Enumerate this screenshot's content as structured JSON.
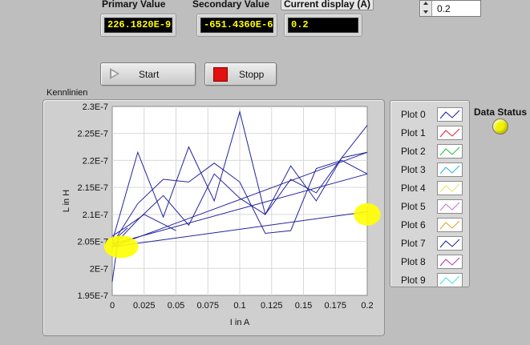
{
  "indicators": {
    "primary": {
      "label": "Primary Value",
      "value": "226.1820E-9"
    },
    "secondary": {
      "label": "Secondary Value",
      "value": "-651.4360E-6"
    },
    "current": {
      "label": "Current display (A)",
      "value": "0.2"
    }
  },
  "top_control": {
    "value": "0.2"
  },
  "buttons": {
    "start": "Start",
    "stop": "Stopp"
  },
  "graph": {
    "label": "Kennlinien"
  },
  "legend": {
    "items": [
      {
        "name": "Plot 0",
        "color": "#1a1ab0"
      },
      {
        "name": "Plot 1",
        "color": "#e0203a"
      },
      {
        "name": "Plot 2",
        "color": "#20c040"
      },
      {
        "name": "Plot 3",
        "color": "#30b0e0"
      },
      {
        "name": "Plot 4",
        "color": "#e8e060"
      },
      {
        "name": "Plot 5",
        "color": "#c070d0"
      },
      {
        "name": "Plot 6",
        "color": "#e0a020"
      },
      {
        "name": "Plot 7",
        "color": "#1a1ab0"
      },
      {
        "name": "Plot 8",
        "color": "#c030a0"
      },
      {
        "name": "Plot 9",
        "color": "#40e0e0"
      }
    ]
  },
  "status": {
    "label": "Data Status",
    "led_color": "#f2f200"
  },
  "chart_data": {
    "type": "line",
    "xlabel": "I in A",
    "ylabel": "L in H",
    "xlim": [
      0,
      0.2
    ],
    "ylim": [
      1.95e-07,
      2.3e-07
    ],
    "x_ticks": [
      "0",
      "0.025",
      "0.05",
      "0.075",
      "0.1",
      "0.125",
      "0.15",
      "0.175",
      "0.2"
    ],
    "y_ticks": [
      "1.95E-7",
      "2E-7",
      "2.05E-7",
      "2.1E-7",
      "2.15E-7",
      "2.2E-7",
      "2.25E-7",
      "2.3E-7"
    ],
    "grid": true,
    "line_color": "#2323a0",
    "series": [
      {
        "x": [
          0,
          0.02,
          0.04,
          0.06,
          0.08,
          0.1,
          0.12,
          0.14,
          0.16,
          0.18,
          0.2
        ],
        "y": [
          2.05e-07,
          2.215e-07,
          2.095e-07,
          2.225e-07,
          2.125e-07,
          2.29e-07,
          2.1e-07,
          2.19e-07,
          2.125e-07,
          2.205e-07,
          2.265e-07
        ]
      },
      {
        "x": [
          0,
          0.02,
          0.04,
          0.06,
          0.08,
          0.1,
          0.12,
          0.14,
          0.16,
          0.18,
          0.2
        ],
        "y": [
          2.045e-07,
          2.12e-07,
          2.165e-07,
          2.16e-07,
          2.195e-07,
          2.16e-07,
          2.065e-07,
          2.07e-07,
          2.185e-07,
          2.2e-07,
          2.175e-07
        ]
      },
      {
        "x": [
          0,
          0.02,
          0.04,
          0.06,
          0.08,
          0.1,
          0.12,
          0.14,
          0.16,
          0.18,
          0.2
        ],
        "y": [
          2.04e-07,
          2.09e-07,
          2.135e-07,
          2.08e-07,
          2.175e-07,
          2.13e-07,
          2.1e-07,
          2.165e-07,
          2.14e-07,
          2.205e-07,
          2.215e-07
        ]
      },
      {
        "x": [
          0,
          0.2
        ],
        "y": [
          2.04e-07,
          2.215e-07
        ]
      },
      {
        "x": [
          0,
          0.2
        ],
        "y": [
          2.045e-07,
          2.175e-07
        ]
      },
      {
        "x": [
          0,
          0.2
        ],
        "y": [
          2.04e-07,
          2.105e-07
        ]
      },
      {
        "x": [
          0,
          0.01,
          0.025,
          0.05
        ],
        "y": [
          2.06e-07,
          2.075e-07,
          2.1e-07,
          2.07e-07
        ]
      },
      {
        "x": [
          0,
          0.005,
          0.012
        ],
        "y": [
          1.975e-07,
          2.06e-07,
          2.075e-07
        ]
      }
    ],
    "annotations": [
      {
        "x": 0.002,
        "y": 2.04e-07,
        "rx": 0.0045,
        "ry": 2.3e-10,
        "color": "#ffff00"
      },
      {
        "x": 0.195,
        "y": 2.1e-07,
        "rx": 0.0035,
        "ry": 2.3e-10,
        "color": "#ffff00"
      }
    ]
  }
}
